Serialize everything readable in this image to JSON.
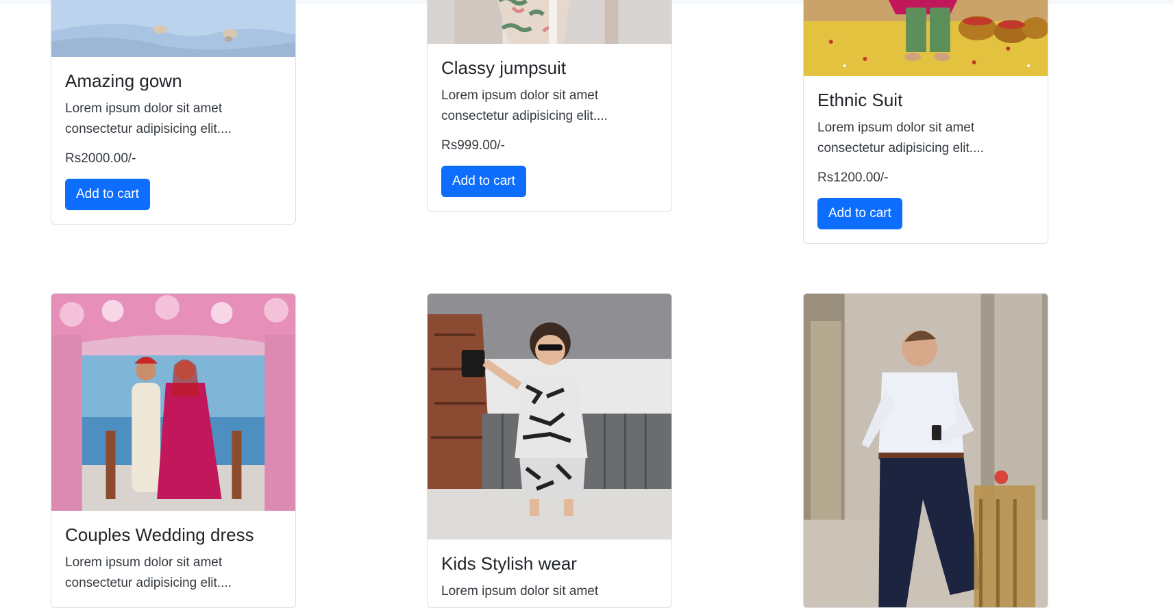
{
  "products": [
    {
      "title": "Amazing gown",
      "desc": "Lorem ipsum dolor sit amet consectetur adipisicing elit....",
      "price": "Rs2000.00/-",
      "button": "Add to cart"
    },
    {
      "title": "Classy jumpsuit",
      "desc": "Lorem ipsum dolor sit amet consectetur adipisicing elit....",
      "price": "Rs999.00/-",
      "button": "Add to cart"
    },
    {
      "title": "Ethnic Suit",
      "desc": "Lorem ipsum dolor sit amet consectetur adipisicing elit....",
      "price": "Rs1200.00/-",
      "button": "Add to cart"
    },
    {
      "title": "Couples Wedding dress",
      "desc": "Lorem ipsum dolor sit amet consectetur adipisicing elit...."
    },
    {
      "title": "Kids Stylish wear",
      "desc": "Lorem ipsum dolor sit amet"
    },
    {
      "title": ""
    }
  ],
  "colors": {
    "button": "#0d6efd",
    "border": "#dcdfe3",
    "text": "#212529"
  }
}
